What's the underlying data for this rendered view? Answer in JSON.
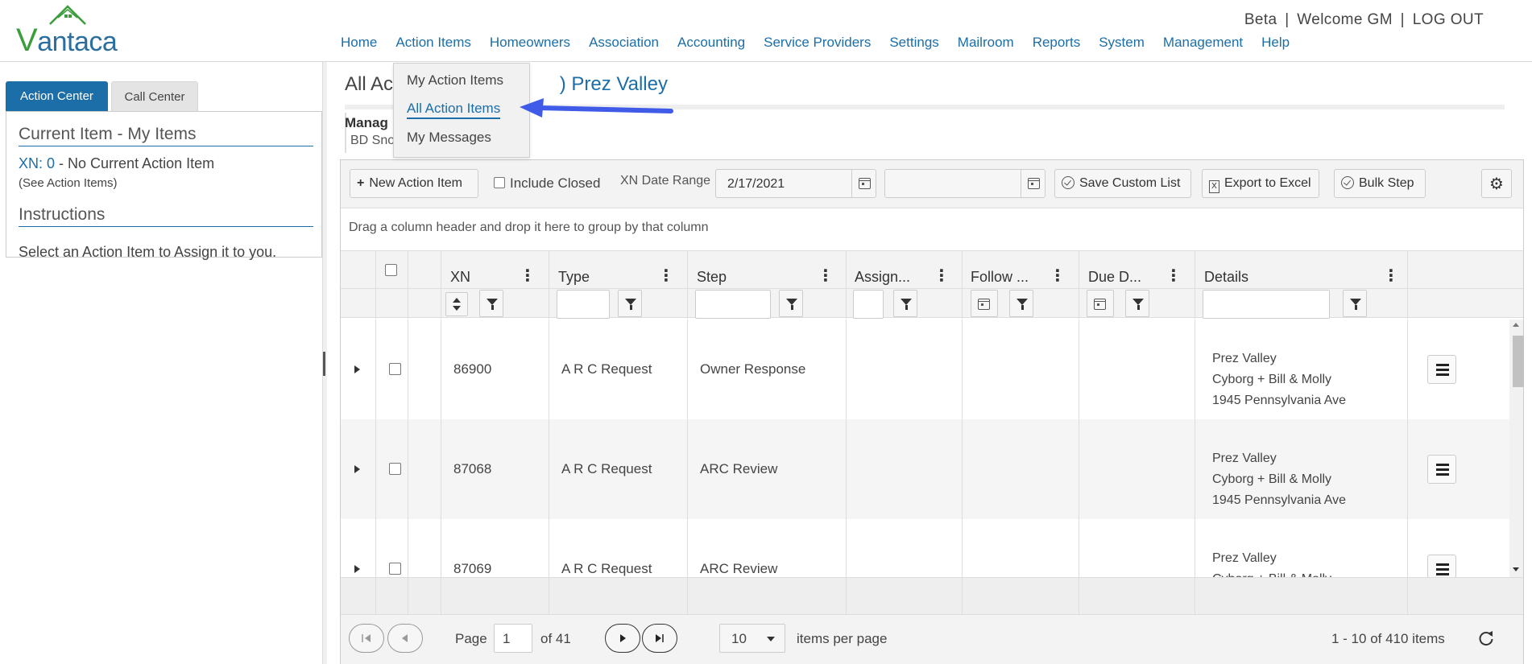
{
  "logo": {
    "text_v": "V",
    "text_rest": "antaca"
  },
  "user_bar": {
    "beta": "Beta",
    "sep1": "|",
    "welcome": "Welcome GM",
    "sep2": "|",
    "logout": "LOG OUT"
  },
  "nav": [
    "Home",
    "Action Items",
    "Homeowners",
    "Association",
    "Accounting",
    "Service Providers",
    "Settings",
    "Mailroom",
    "Reports",
    "System",
    "Management",
    "Help"
  ],
  "dropdown": {
    "items": [
      "My Action Items",
      "All Action Items",
      "My Messages"
    ],
    "active_index": 1
  },
  "left_panel": {
    "tabs": [
      "Action Center",
      "Call Center"
    ],
    "current_heading": "Current Item - My Items",
    "xn_label": "XN: 0",
    "xn_text": "- No Current Action Item",
    "see_link": "(See Action Items)",
    "instructions_heading": "Instructions",
    "instructions_text": "Select an Action Item to Assign it to you."
  },
  "main": {
    "title_prefix": "All Act",
    "title_link": ") Prez Valley",
    "manag": "Manag",
    "bd": "BD Sno"
  },
  "toolbar": {
    "new_item": "New Action Item",
    "include_closed": "Include Closed",
    "xn_date_range": "XN Date Range",
    "date_from": "2/17/2021",
    "date_to": "",
    "save_list": "Save Custom List",
    "export": "Export to Excel",
    "bulk_step": "Bulk Step"
  },
  "group_hint": "Drag a column header and drop it here to group by that column",
  "columns": [
    "XN",
    "Type",
    "Step",
    "Assign...",
    "Follow ...",
    "Due D...",
    "Details"
  ],
  "rows": [
    {
      "xn": "86900",
      "type": "A R C Request",
      "step": "Owner Response",
      "details": [
        "Prez Valley",
        "Cyborg + Bill & Molly",
        "1945 Pennsylvania Ave"
      ]
    },
    {
      "xn": "87068",
      "type": "A R C Request",
      "step": "ARC Review",
      "details": [
        "Prez Valley",
        "Cyborg + Bill & Molly",
        "1945 Pennsylvania Ave"
      ]
    },
    {
      "xn": "87069",
      "type": "A R C Request",
      "step": "ARC Review",
      "details": [
        "Prez Valley",
        "Cyborg + Bill & Molly",
        ""
      ]
    }
  ],
  "pager": {
    "page_label": "Page",
    "page": "1",
    "of": "of 41",
    "per_page": "10",
    "per_page_label": "items per page",
    "summary": "1 - 10 of 410 items"
  },
  "colors": {
    "accent": "#1b6ea8",
    "arrow": "#3f5be8",
    "logo_green": "#3b9d3b"
  }
}
